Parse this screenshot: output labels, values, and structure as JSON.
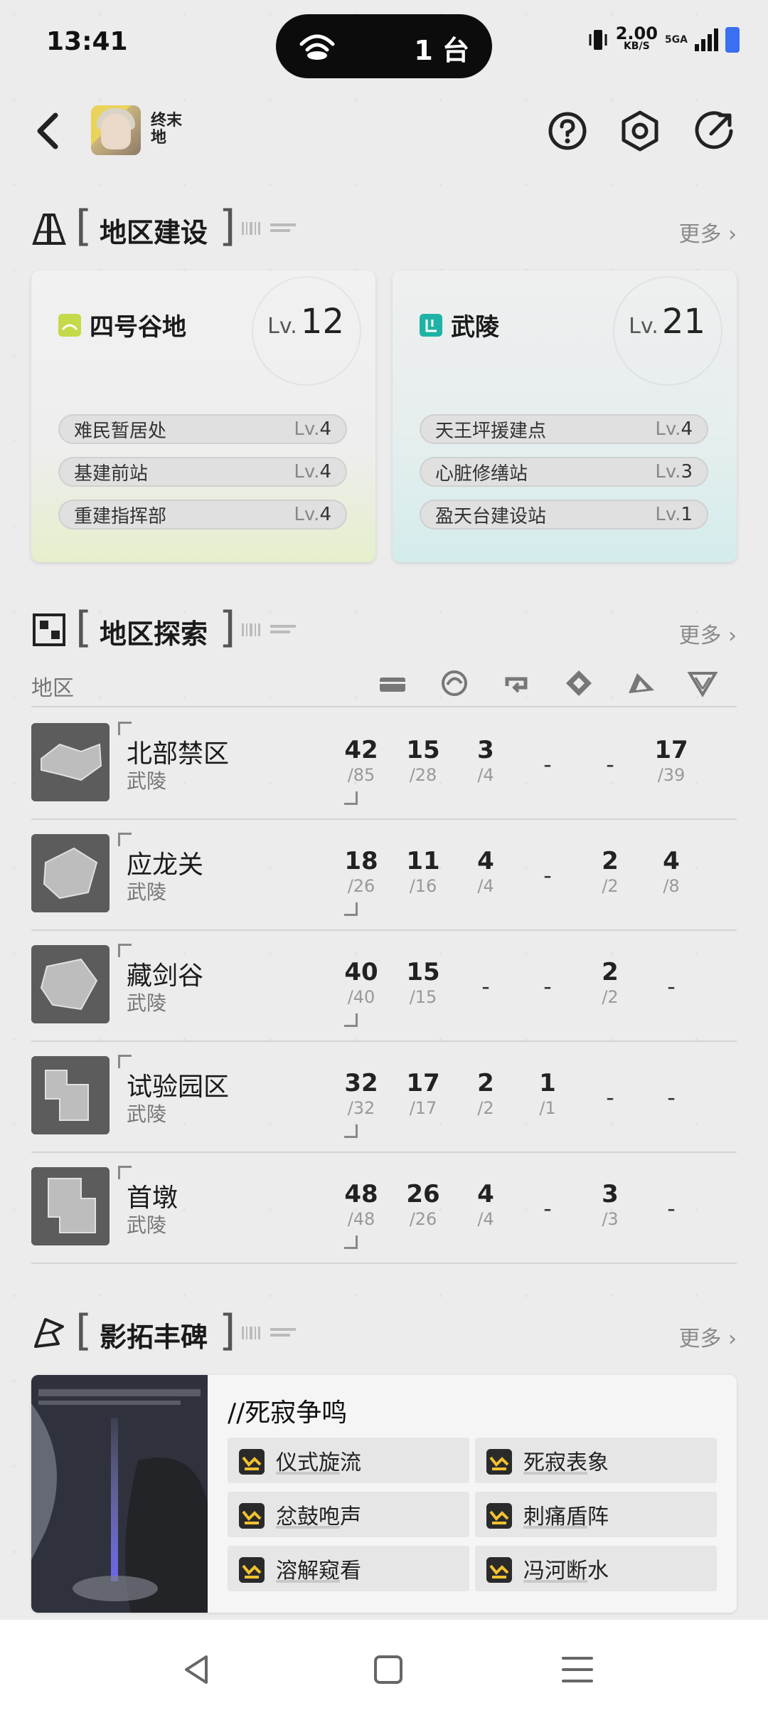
{
  "status_bar": {
    "time": "13:41",
    "island_count": "1 台",
    "net_speed": "2.00",
    "net_unit": "KB/S",
    "network": "5GA"
  },
  "header": {
    "back_icon": "chevron-left-icon",
    "logo_text": "终末地",
    "help_icon": "help-icon",
    "settings_icon": "hexagon-gear-icon",
    "share_icon": "share-icon"
  },
  "construction": {
    "title": "地区建设",
    "more": "更多",
    "regions": [
      {
        "name": "四号谷地",
        "lv_prefix": "Lv.",
        "level": "12",
        "badge_color": "#c6d94a",
        "buildings": [
          {
            "name": "难民暂居处",
            "lv_prefix": "Lv.",
            "lv": "4"
          },
          {
            "name": "基建前站",
            "lv_prefix": "Lv.",
            "lv": "4"
          },
          {
            "name": "重建指挥部",
            "lv_prefix": "Lv.",
            "lv": "4"
          }
        ]
      },
      {
        "name": "武陵",
        "lv_prefix": "Lv.",
        "level": "21",
        "badge_color": "#1fb3a6",
        "buildings": [
          {
            "name": "天王坪援建点",
            "lv_prefix": "Lv.",
            "lv": "4"
          },
          {
            "name": "心脏修缮站",
            "lv_prefix": "Lv.",
            "lv": "3"
          },
          {
            "name": "盈天台建设站",
            "lv_prefix": "Lv.",
            "lv": "1"
          }
        ]
      }
    ]
  },
  "exploration": {
    "title": "地区探索",
    "more": "更多",
    "col_label": "地区",
    "col_icons": [
      "chest-icon",
      "swirl-icon",
      "loop-icon",
      "diamond-icon",
      "crystal-icon",
      "shard-icon"
    ],
    "rows": [
      {
        "name": "北部禁区",
        "region": "武陵",
        "stats": [
          {
            "c": "42",
            "t": "/85"
          },
          {
            "c": "15",
            "t": "/28"
          },
          {
            "c": "3",
            "t": "/4"
          },
          {
            "c": "-",
            "t": ""
          },
          {
            "c": "-",
            "t": ""
          },
          {
            "c": "17",
            "t": "/39"
          }
        ]
      },
      {
        "name": "应龙关",
        "region": "武陵",
        "stats": [
          {
            "c": "18",
            "t": "/26"
          },
          {
            "c": "11",
            "t": "/16"
          },
          {
            "c": "4",
            "t": "/4"
          },
          {
            "c": "-",
            "t": ""
          },
          {
            "c": "2",
            "t": "/2"
          },
          {
            "c": "4",
            "t": "/8"
          }
        ]
      },
      {
        "name": "藏剑谷",
        "region": "武陵",
        "stats": [
          {
            "c": "40",
            "t": "/40"
          },
          {
            "c": "15",
            "t": "/15"
          },
          {
            "c": "-",
            "t": ""
          },
          {
            "c": "-",
            "t": ""
          },
          {
            "c": "2",
            "t": "/2"
          },
          {
            "c": "-",
            "t": ""
          }
        ]
      },
      {
        "name": "试验园区",
        "region": "武陵",
        "stats": [
          {
            "c": "32",
            "t": "/32"
          },
          {
            "c": "17",
            "t": "/17"
          },
          {
            "c": "2",
            "t": "/2"
          },
          {
            "c": "1",
            "t": "/1"
          },
          {
            "c": "-",
            "t": ""
          },
          {
            "c": "-",
            "t": ""
          }
        ]
      },
      {
        "name": "首墩",
        "region": "武陵",
        "stats": [
          {
            "c": "48",
            "t": "/48"
          },
          {
            "c": "26",
            "t": "/26"
          },
          {
            "c": "4",
            "t": "/4"
          },
          {
            "c": "-",
            "t": ""
          },
          {
            "c": "3",
            "t": "/3"
          },
          {
            "c": "-",
            "t": ""
          }
        ]
      }
    ]
  },
  "achievements": {
    "title": "影拓丰碑",
    "more": "更多",
    "card_title": "//死寂争鸣",
    "items": [
      "仪式旋流",
      "死寂表象",
      "忿鼓咆声",
      "刺痛盾阵",
      "溶解窥看",
      "冯河断水"
    ]
  },
  "nav": {
    "back": "triangle-back-icon",
    "home": "square-home-icon",
    "menu": "menu-lines-icon"
  }
}
